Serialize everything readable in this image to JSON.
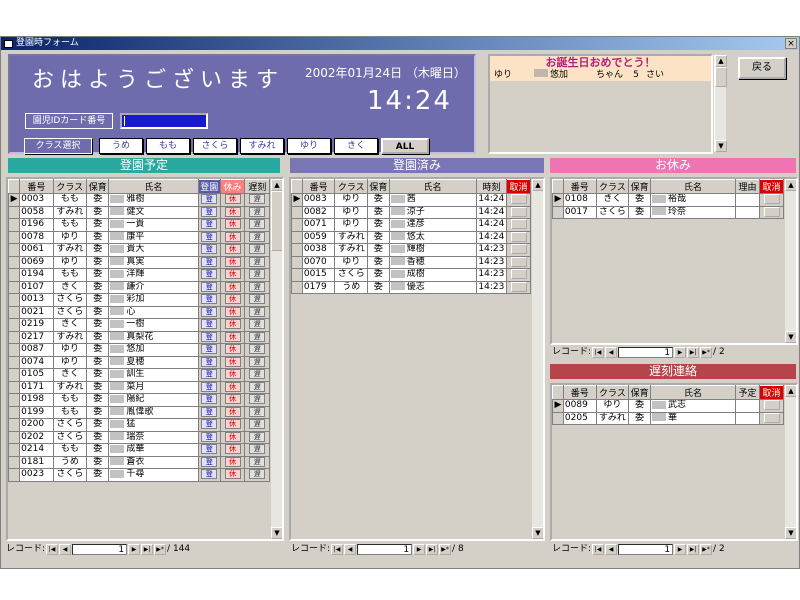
{
  "window": {
    "title": "登園時フォーム"
  },
  "greeting": "おはようございます",
  "date": "2002年01月24日 （木曜日）",
  "time": "14:24",
  "card_label": "園児IDカード番号",
  "class_label": "クラス選択",
  "class_buttons": [
    "うめ",
    "もも",
    "さくら",
    "すみれ",
    "ゆり",
    "きく",
    "ALL"
  ],
  "birthday": {
    "title": "お誕生日おめでとう！",
    "row": {
      "class": "ゆり",
      "name": "悠加",
      "suffix": "ちゃん",
      "age": "5",
      "age_unit": "さい"
    }
  },
  "back_button": "戻る",
  "scheduled": {
    "title": "登園予定",
    "headers": [
      "番号",
      "クラス",
      "保育",
      "氏名",
      "登園",
      "休み",
      "遅刻"
    ],
    "button_labels": [
      "登",
      "休",
      "遅"
    ],
    "rows": [
      [
        "0003",
        "もも",
        "委",
        "雅樹"
      ],
      [
        "0058",
        "すみれ",
        "委",
        "健文"
      ],
      [
        "0196",
        "もも",
        "委",
        "一貴"
      ],
      [
        "0078",
        "ゆり",
        "委",
        "康平"
      ],
      [
        "0061",
        "すみれ",
        "委",
        "貴大"
      ],
      [
        "0069",
        "ゆり",
        "委",
        "真実"
      ],
      [
        "0194",
        "もも",
        "委",
        "洋輝"
      ],
      [
        "0107",
        "きく",
        "委",
        "謙介"
      ],
      [
        "0013",
        "さくら",
        "委",
        "彩加"
      ],
      [
        "0021",
        "さくら",
        "委",
        "心"
      ],
      [
        "0219",
        "きく",
        "委",
        "一樹"
      ],
      [
        "0217",
        "すみれ",
        "委",
        "真梨花"
      ],
      [
        "0087",
        "ゆり",
        "委",
        "悠加"
      ],
      [
        "0074",
        "ゆり",
        "委",
        "夏穂"
      ],
      [
        "0105",
        "きく",
        "委",
        "訓生"
      ],
      [
        "0171",
        "すみれ",
        "委",
        "菜月"
      ],
      [
        "0198",
        "もも",
        "委",
        "陽紀"
      ],
      [
        "0199",
        "もも",
        "委",
        "胤偉歌"
      ],
      [
        "0200",
        "さくら",
        "委",
        "猛"
      ],
      [
        "0202",
        "さくら",
        "委",
        "瑞奈"
      ],
      [
        "0214",
        "もも",
        "委",
        "成華"
      ],
      [
        "0181",
        "うめ",
        "委",
        "蒼衣"
      ],
      [
        "0023",
        "さくら",
        "委",
        "千尋"
      ]
    ],
    "record_label": "レコード:",
    "record_current": "1",
    "record_total": "/ 144"
  },
  "arrived": {
    "title": "登園済み",
    "headers": [
      "番号",
      "クラス",
      "保育",
      "氏名",
      "時刻",
      "取消"
    ],
    "rows": [
      [
        "0083",
        "ゆり",
        "委",
        "茜",
        "14:24"
      ],
      [
        "0082",
        "ゆり",
        "委",
        "涼子",
        "14:24"
      ],
      [
        "0071",
        "ゆり",
        "委",
        "達彦",
        "14:24"
      ],
      [
        "0059",
        "すみれ",
        "委",
        "悠太",
        "14:24"
      ],
      [
        "0038",
        "すみれ",
        "委",
        "輝樹",
        "14:23"
      ],
      [
        "0070",
        "ゆり",
        "委",
        "香穂",
        "14:23"
      ],
      [
        "0015",
        "さくら",
        "委",
        "成樹",
        "14:23"
      ],
      [
        "0179",
        "うめ",
        "委",
        "優志",
        "14:23"
      ]
    ],
    "record_label": "レコード:",
    "record_current": "1",
    "record_total": "/ 8"
  },
  "absent": {
    "title": "お休み",
    "headers": [
      "番号",
      "クラス",
      "保育",
      "氏名",
      "理由",
      "取消"
    ],
    "rows": [
      [
        "0108",
        "きく",
        "委",
        "裕哉",
        ""
      ],
      [
        "0017",
        "さくら",
        "委",
        "玲奈",
        ""
      ]
    ],
    "record_label": "レコード:",
    "record_current": "1",
    "record_total": "/ 2"
  },
  "late": {
    "title": "遅刻連絡",
    "headers": [
      "番号",
      "クラス",
      "保育",
      "氏名",
      "予定",
      "取消"
    ],
    "rows": [
      [
        "0089",
        "ゆり",
        "委",
        "武志",
        ""
      ],
      [
        "0205",
        "すみれ",
        "委",
        "華",
        ""
      ]
    ],
    "record_label": "レコード:",
    "record_current": "1",
    "record_total": "/ 2"
  },
  "colors": {
    "scheduled_header": "#2aa9a0",
    "arrived_header": "#7a76b4",
    "absent_header": "#ef74b3",
    "late_header": "#b5454b",
    "accent": "#6f6cad"
  }
}
